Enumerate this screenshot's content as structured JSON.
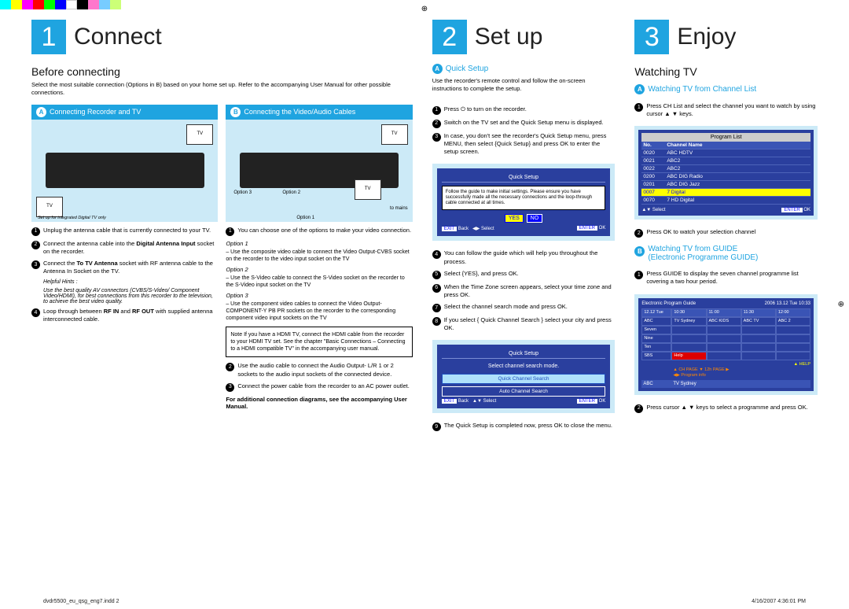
{
  "registration": "⊕",
  "col1": {
    "num": "1",
    "title": "Connect",
    "section": "Before connecting",
    "intro": "Select the most suitable connection (Options in B) based on your home set up.  Refer to the accompanying User Manual for other possible connections.",
    "A": {
      "letter": "A",
      "title": "Connecting Recorder and TV",
      "caption": "Set up for integrated Digital TV only",
      "s1": "Unplug the antenna cable that is currently connected to your TV.",
      "s2a": "Connect the antenna cable into the ",
      "s2b": "Digital Antenna Input",
      "s2c": " socket on the recorder.",
      "s3a": "Connect the ",
      "s3b": "To TV Antenna",
      "s3c": " socket with RF antenna cable to the Antenna In Socket on the TV.",
      "hintTitle": "Helpful Hints :",
      "hint": "Use the best quality AV connectors (CVBS/S-Video/ Component Video/HDMI), for best connections from this recorder to the television, to achieve the best video quality.",
      "s4a": "Loop through between ",
      "s4b": "RF IN",
      "s4c": " and ",
      "s4d": "RF OUT",
      "s4e": " with supplied antenna interconnected cable."
    },
    "B": {
      "letter": "B",
      "title": "Connecting the Video/Audio Cables",
      "opt1l": "Option 1",
      "opt2l": "Option 2",
      "opt3l": "Option 3",
      "mains": "to mains",
      "s1": "You can choose one of the options to make your video connection.",
      "o1l": "Option 1",
      "o1t": "– Use the composite video cable to connect the Video Output-CVBS socket on the recorder to the video input socket on the TV",
      "o2l": "Option 2",
      "o2t": "– Use the S-Video cable to connect the S-Video socket on the recorder to the S-Video input socket on the TV",
      "o3l": "Option 3",
      "o3t": "– Use the component video cables to connect the Video Output-COMPONENT-Y PB PR sockets on the recorder to the corresponding component video input sockets on the TV",
      "note": "Note If you have a HDMI TV, connect the HDMI cable from the recorder to your HDMI TV set. See the chapter \"Basic Connections – Connecting to a HDMI compatible TV\" in the accompanying user manual.",
      "s2": "Use the audio cable to connect the Audio Output- L/R 1 or 2 sockets to the audio input sockets of the connected device.",
      "s3": "Connect the power cable from the recorder to an AC power outlet.",
      "add": "For additional connection diagrams, see the accompanying User Manual."
    }
  },
  "col2": {
    "num": "2",
    "title": "Set up",
    "A": {
      "letter": "A",
      "title": "Quick Setup",
      "intro": "Use the recorder's remote control and follow the on-screen instructions to complete the setup.",
      "s1": "Press ⏻  to turn on the recorder.",
      "s2": "Switch on the TV set and the Quick Setup menu is displayed.",
      "s3": "In case, you don't see the recorder's Quick Setup menu, press MENU, then select {Quick Setup} and press OK to enter the setup screen.",
      "osd1_title": "Quick Setup",
      "osd1_msg": "Follow the guide to make initial settings. Please ensure you have successfully made all the necessary connections and the loop-through cable connected at all times.",
      "yes": "YES",
      "no": "NO",
      "exit": "EXIT",
      "back": "Back",
      "select": "Select",
      "enter": "ENTER",
      "ok": "OK",
      "s4": "You can follow the guide which will help you throughout the process.",
      "s5": "Select {YES}, and press OK.",
      "s6": "When the Time Zone screen appears, select your time zone and press OK.",
      "s7": "Select the channel search mode and press OK.",
      "s8": "If you select { Quick Channel Search } select your city and press OK.",
      "osd2_title": "Quick Setup",
      "osd2_msg": "Select channel search mode.",
      "osd2_opt1": "Quick Channel Search",
      "osd2_opt2": "Auto Channel Search",
      "s9": "The Quick Setup is completed now, press OK to close the menu."
    }
  },
  "col3": {
    "num": "3",
    "title": "Enjoy",
    "section": "Watching TV",
    "A": {
      "letter": "A",
      "title": "Watching TV from Channel List",
      "s1": "Press CH List and select the channel you want to watch by using cursor ▲ ▼ keys.",
      "pl_title": "Program List",
      "hdr_no": "No.",
      "hdr_name": "Channel Name",
      "rows": [
        {
          "no": "0020",
          "name": "ABC HDTV"
        },
        {
          "no": "0021",
          "name": "ABC2"
        },
        {
          "no": "0022",
          "name": "ABC2"
        },
        {
          "no": "0200",
          "name": "ABC DIG Radio"
        },
        {
          "no": "0201",
          "name": "ABC DIG Jazz"
        },
        {
          "no": "0007",
          "name": "7 Digital"
        },
        {
          "no": "0070",
          "name": "7 HD Digital"
        }
      ],
      "foot_sel": "▲▼ Select",
      "foot_enter": "ENTER",
      "foot_ok": "OK",
      "s2": "Press OK to watch your selection channel"
    },
    "B": {
      "letter": "B",
      "title1": "Watching TV from GUIDE",
      "title2": "(Electronic Programme GUIDE)",
      "s1": "Press GUIDE to display the seven channel programme list covering a two hour period.",
      "epg_title": "Electronic Program Guide",
      "epg_date": "2006  13.12 Tue    10:33",
      "times": [
        "12.12 Tue",
        "10:30",
        "11:00",
        "11:30",
        "12:00"
      ],
      "chRows": [
        {
          "ch": "ABC",
          "cells": [
            "TV Sydney",
            "ABC KIDS",
            "ABC TV",
            "ABC 2"
          ]
        },
        {
          "ch": "Seven",
          "cells": [
            "",
            "",
            "",
            ""
          ]
        },
        {
          "ch": "Nine",
          "cells": [
            "",
            "",
            "",
            ""
          ]
        },
        {
          "ch": "Ten",
          "cells": [
            "",
            "",
            "",
            ""
          ]
        },
        {
          "ch": "SBS",
          "cells": [
            "Help",
            "",
            "",
            ""
          ]
        }
      ],
      "help1": "▲ HELP",
      "help2": "▲ CH PAGE ▼ 12h PAGE ▶",
      "help3": "◀▶ Program info",
      "foot_ch": "ABC",
      "foot_prog": "TV Sydney",
      "s2": "Press cursor ▲ ▼ keys to select a programme and press OK."
    }
  },
  "footer": {
    "file": "dvdr5500_eu_qsg_eng7.indd   2",
    "date": "4/16/2007   4:36:01 PM"
  }
}
